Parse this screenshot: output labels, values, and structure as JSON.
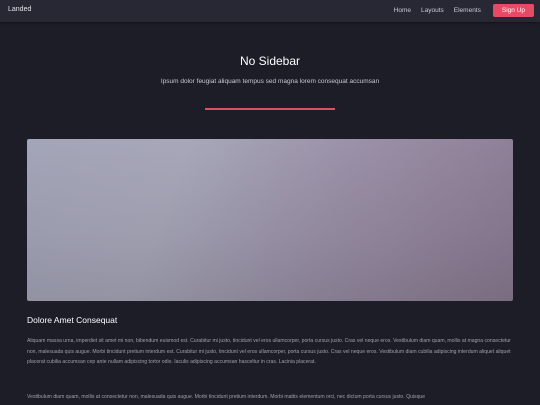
{
  "header": {
    "logo": "Landed",
    "nav": [
      "Home",
      "Layouts",
      "Elements"
    ],
    "signup_label": "Sign Up"
  },
  "page": {
    "title": "No Sidebar",
    "subtitle": "Ipsum dolor feugiat aliquam tempus sed magna lorem consequat accumsan"
  },
  "section": {
    "heading": "Dolore Amet Consequat",
    "paragraphs": [
      "Aliquam massa urna, imperdiet sit amet mi non, bibendum euismod est. Curabitur mi justo, tincidunt vel eros ullamcorper, porta cursus justo. Cras vel neque eros. Vestibulum diam quam, mollis at magna consectetur non, malesuada quis augue. Morbi tincidunt pretium interdum est. Curabitur mi justo, tincidunt vel eros ullamcorper, porta cursus justo. Cras vel neque eros. Vestibulum diam cubilia adipiscing interdum aliquet aliquet placerat cubilia accumsan cep ante nullam adipiscing tortor odio. Iaculis adipiscing accumsan hasceltur in cras. Lacinia placerat.",
      "Vestibulum diam quam, mollis at consectetur non, malesuada quis augue. Morbi tincidunt pretium interdum. Morbi mattis elementum orci, nec dictum porta cursus justo. Quisque"
    ]
  },
  "colors": {
    "accent": "#e44c65",
    "background": "#1c1d26",
    "header": "#272833"
  }
}
